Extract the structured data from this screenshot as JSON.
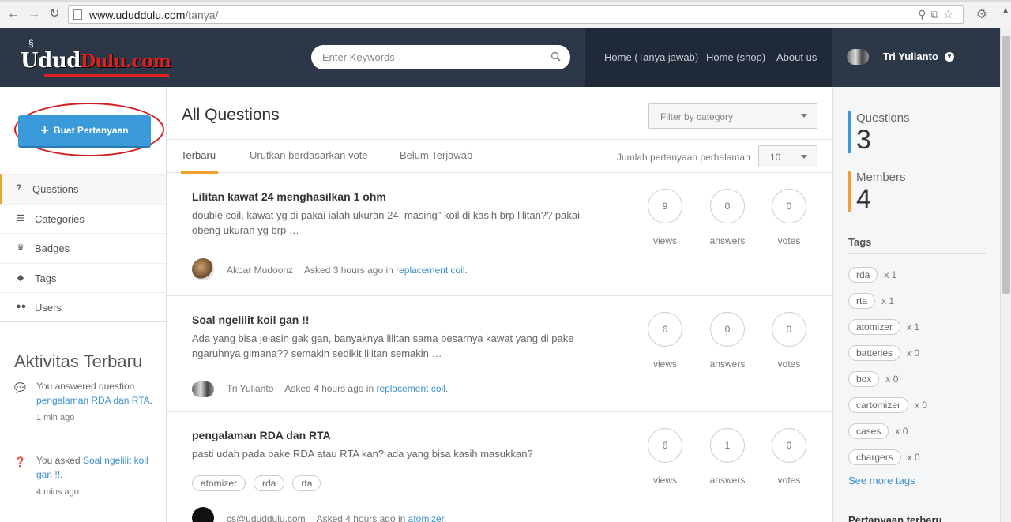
{
  "browser": {
    "url_host": "www.ududdulu.com",
    "url_path": "/tanya/"
  },
  "header": {
    "logo_part1": "Udud",
    "logo_part2": "Dulu.com",
    "search_placeholder": "Enter Keywords",
    "nav": [
      "Home (Tanya jawab)",
      "Home (shop)",
      "About us"
    ],
    "user_name": "Tri Yulianto"
  },
  "sidebar": {
    "ask_button": "Buat Pertanyaan",
    "items": [
      {
        "label": "Questions",
        "icon": "?"
      },
      {
        "label": "Categories",
        "icon": "☰"
      },
      {
        "label": "Badges",
        "icon": "🏆"
      },
      {
        "label": "Tags",
        "icon": "🏷"
      },
      {
        "label": "Users",
        "icon": "👥"
      }
    ],
    "activity_title": "Aktivitas Terbaru",
    "activities": [
      {
        "prefix": "You answered question ",
        "link": "pengalaman RDA dan RTA",
        "suffix": ".",
        "time": "1 min ago"
      },
      {
        "prefix": "You asked ",
        "link": "Soal ngelilit koil gan !!",
        "suffix": ".",
        "time": "4 mins ago"
      }
    ]
  },
  "main": {
    "title": "All Questions",
    "filter_placeholder": "Filter by category",
    "tabs": [
      "Terbaru",
      "Urutkan berdasarkan vote",
      "Belum Terjawab"
    ],
    "per_page_label": "Jumlah pertanyaan perhalaman",
    "per_page_value": "10",
    "stat_labels": {
      "views": "views",
      "answers": "answers",
      "votes": "votes"
    },
    "questions": [
      {
        "title": "Lilitan kawat 24 menghasilkan 1 ohm",
        "excerpt": "double coil, kawat yg di pakai ialah ukuran 24, masing\" koil di kasih brp lilitan?? pakai obeng ukuran yg brp …",
        "author": "Akbar Mudoonz",
        "asked": "Asked 3 hours ago in ",
        "category": "replacement coil",
        "views": "9",
        "answers": "0",
        "votes": "0",
        "tags": []
      },
      {
        "title": "Soal ngelilit koil gan !!",
        "excerpt": "Ada yang bisa jelasin gak gan, banyaknya lilitan sama besarnya kawat yang di pake ngaruhnya gimana?? semakin sedikit lilitan semakin …",
        "author": "Tri Yulianto",
        "asked": "Asked 4 hours ago in ",
        "category": "replacement coil",
        "views": "6",
        "answers": "0",
        "votes": "0",
        "tags": []
      },
      {
        "title": "pengalaman RDA dan RTA",
        "excerpt": "pasti udah pada pake RDA atau RTA kan? ada yang bisa kasih masukkan?",
        "author": "cs@ududdulu.com",
        "asked": "Asked 4 hours ago in ",
        "category": "atomizer",
        "views": "6",
        "answers": "1",
        "votes": "0",
        "tags": [
          "atomizer",
          "rda",
          "rta"
        ]
      }
    ]
  },
  "right": {
    "questions_label": "Questions",
    "questions_count": "3",
    "members_label": "Members",
    "members_count": "4",
    "tags_title": "Tags",
    "tags": [
      {
        "name": "rda",
        "count": "x 1"
      },
      {
        "name": "rta",
        "count": "x 1"
      },
      {
        "name": "atomizer",
        "count": "x 1"
      },
      {
        "name": "batteries",
        "count": "x 0"
      },
      {
        "name": "box",
        "count": "x 0"
      },
      {
        "name": "cartomizer",
        "count": "x 0"
      },
      {
        "name": "cases",
        "count": "x 0"
      },
      {
        "name": "chargers",
        "count": "x 0"
      }
    ],
    "see_more": "See more tags",
    "recent_title": "Pertanyaan terbaru"
  },
  "colors": {
    "header_bg": "#2c3848",
    "nav_bg": "#1f2937",
    "accent_blue": "#3a9ad9",
    "accent_orange": "#f0a030",
    "link": "#3a8fce",
    "highlight_red": "#d21f1f"
  }
}
